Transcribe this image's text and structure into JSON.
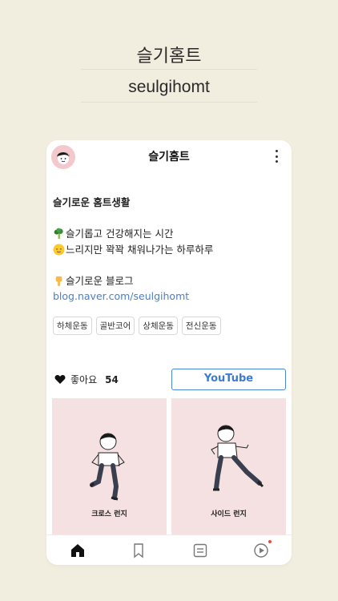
{
  "hero": {
    "title": "슬기홈트",
    "subtitle": "seulgihomt"
  },
  "profile": {
    "name": "슬기홈트",
    "avatar_icon": "avatar-illustration",
    "more_icon": "more-vertical-icon"
  },
  "bio": {
    "title": "슬기로운 홈트생활",
    "line1": "슬기롭고 건강해지는 시간",
    "line2": "느리지만 꽉꽉 채워나가는 하루하루",
    "line3": "슬기로운 블로그",
    "link": "blog.naver.com/seulgihomt",
    "emoji1": "broccoli",
    "emoji2": "relieved-face",
    "emoji3": "pointing-down-hand"
  },
  "tags": [
    "하체운동",
    "골반코어",
    "상체운동",
    "전신운동"
  ],
  "likes": {
    "label": "좋아요",
    "count": "54"
  },
  "youtube_button": "YouTube",
  "cards": [
    {
      "label": "크로스 런지"
    },
    {
      "label": "사이드 런지"
    }
  ],
  "tabbar": {
    "items": [
      "home-icon",
      "bookmark-icon",
      "list-icon",
      "play-icon"
    ],
    "active": "home-icon",
    "notification_dot_color": "#e74c3c"
  },
  "colors": {
    "background": "#f1eddf",
    "card": "#f5e1e1",
    "accent": "#4a86d6"
  }
}
